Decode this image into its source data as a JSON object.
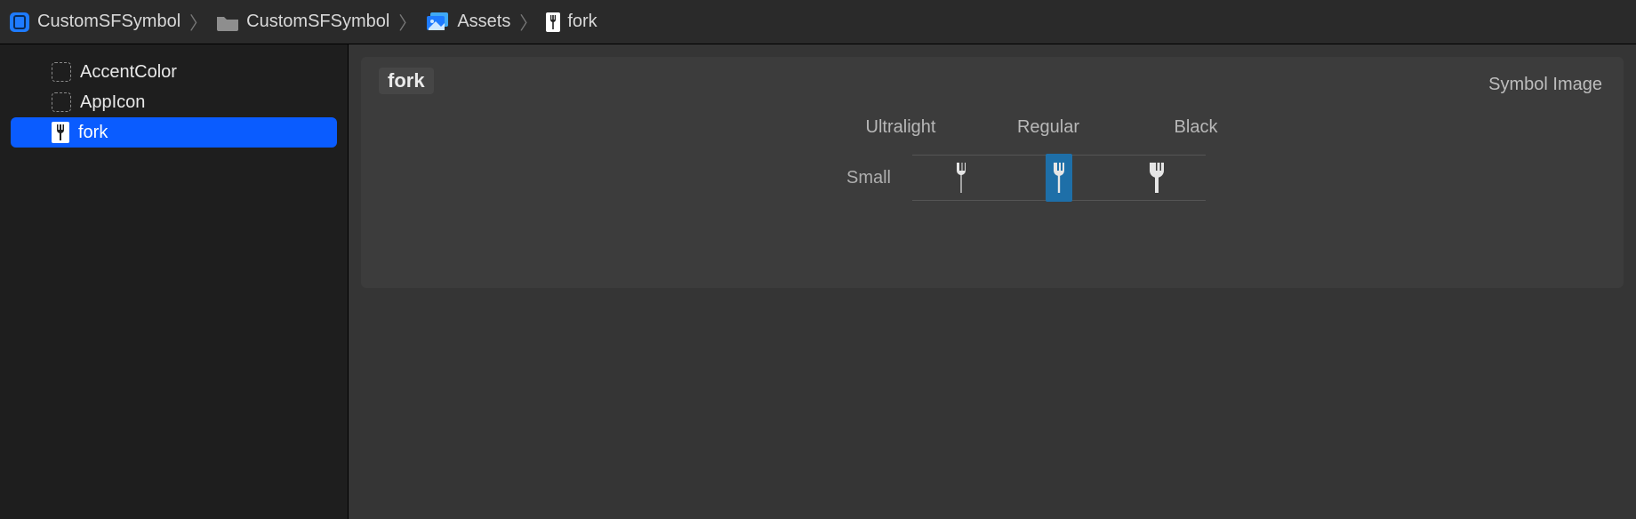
{
  "breadcrumb": [
    {
      "icon": "app-icon",
      "label": "CustomSFSymbol"
    },
    {
      "icon": "folder-icon",
      "label": "CustomSFSymbol"
    },
    {
      "icon": "assets-icon",
      "label": "Assets"
    },
    {
      "icon": "symbol-icon",
      "label": "fork"
    }
  ],
  "sidebar": {
    "items": [
      {
        "icon": "placeholder",
        "label": "AccentColor",
        "selected": false
      },
      {
        "icon": "placeholder",
        "label": "AppIcon",
        "selected": false
      },
      {
        "icon": "fork",
        "label": "fork",
        "selected": true
      }
    ]
  },
  "detail": {
    "title": "fork",
    "type_label": "Symbol Image",
    "weights": [
      "Ultralight",
      "Regular",
      "Black"
    ],
    "sizes": [
      "Small"
    ],
    "selected_weight": "Regular",
    "selected_size": "Small"
  }
}
